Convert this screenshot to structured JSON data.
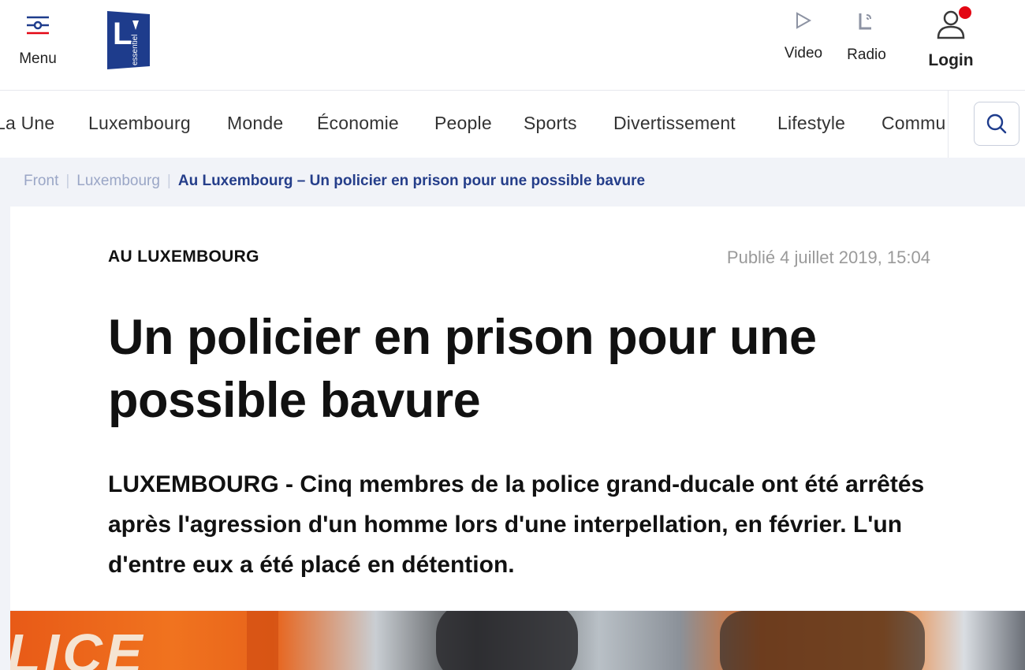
{
  "header": {
    "menu_label": "Menu",
    "logo_icon": "lessentiel-logo-icon",
    "video_label": "Video",
    "radio_label": "Radio",
    "login_label": "Login",
    "brand_color": "#1e3c8c",
    "notification_color": "#e30613"
  },
  "nav": {
    "items": [
      {
        "label": "La Une"
      },
      {
        "label": "Luxembourg"
      },
      {
        "label": "Monde"
      },
      {
        "label": "Économie"
      },
      {
        "label": "People"
      },
      {
        "label": "Sports"
      },
      {
        "label": "Divertissement"
      },
      {
        "label": "Lifestyle"
      },
      {
        "label": "Commu"
      }
    ],
    "search_icon": "search-icon"
  },
  "breadcrumb": {
    "items": [
      "Front",
      "Luxembourg"
    ],
    "current": "Au Luxembourg – Un policier en prison pour une possible bavure"
  },
  "article": {
    "kicker": "AU LUXEMBOURG",
    "published": "Publié 4 juillet 2019, 15:04",
    "headline": "Un policier en prison pour une possible bavure",
    "lead": "LUXEMBOURG - Cinq membres de la police grand-ducale ont été arrêtés après l'agression d'un homme lors d'une interpellation, en février. L'un d'entre eux a été placé en détention.",
    "hero_text": "LICE"
  }
}
